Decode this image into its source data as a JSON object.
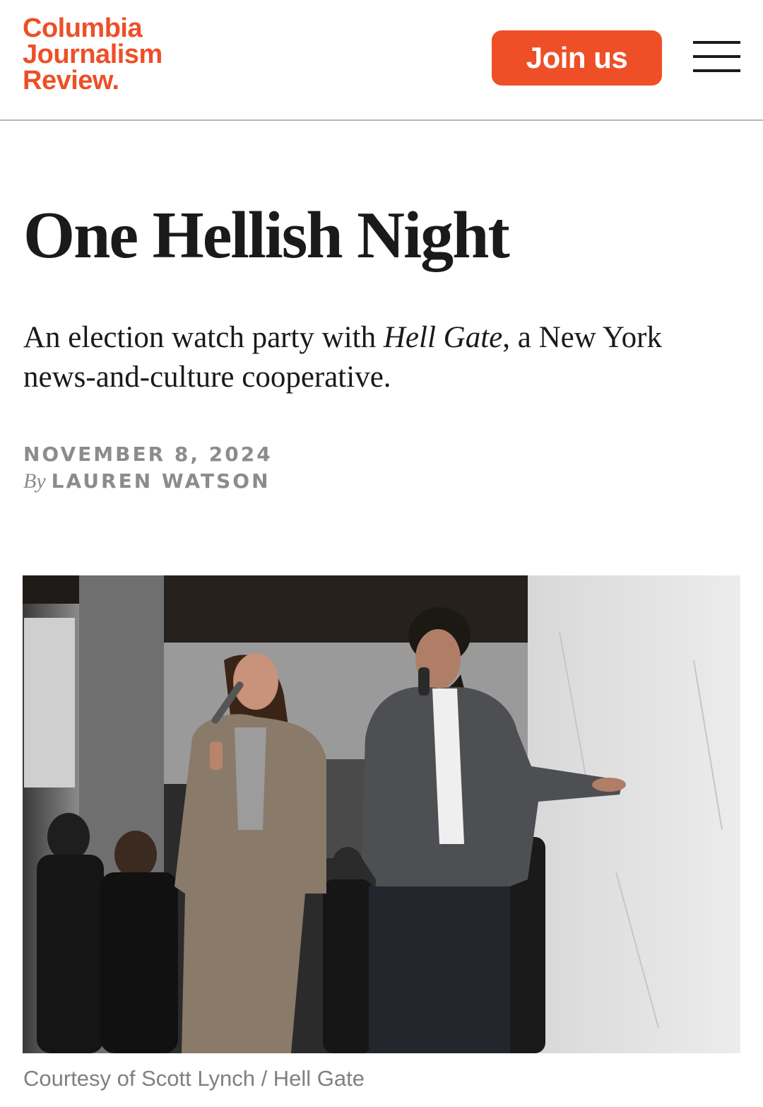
{
  "header": {
    "logo_line1": "Columbia",
    "logo_line2": "Journalism",
    "logo_line3": "Review.",
    "join_label": "Join us",
    "menu_icon": "hamburger-menu-icon"
  },
  "article": {
    "title": "One Hellish Night",
    "dek_before": "An election watch party with ",
    "dek_italic": "Hell Gate",
    "dek_after": ", a New York news-and-culture cooperative.",
    "date": "NOVEMBER 8, 2024",
    "by": "By",
    "author": "LAUREN WATSON",
    "photo_caption": "Courtesy of Scott Lynch / Hell Gate"
  },
  "colors": {
    "brand": "#ee4f27",
    "meta_gray": "#8c8c8c",
    "divider": "#b9b9b9"
  }
}
